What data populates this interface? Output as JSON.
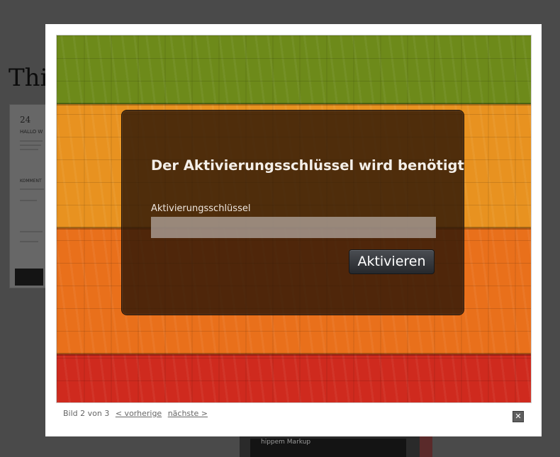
{
  "background_page": {
    "title": "Thi",
    "post_date": "24",
    "post_heading": "HALLO W",
    "comments_label": "KOMMENT",
    "footer_snippet": "hippem Markup"
  },
  "lightbox": {
    "panel": {
      "title": "Der Aktivierungsschlüssel wird benötigt",
      "field_label": "Aktivierungsschlüssel",
      "field_value": "",
      "field_placeholder": "",
      "button_label": "Aktivieren"
    },
    "caption": {
      "counter": "Bild 2 von 3",
      "prev_label": "< vorherige",
      "next_label": "nächste >"
    },
    "close_icon": "close-icon",
    "colors": {
      "green": "#6d8a1a",
      "orange": "#e89220",
      "deep_orange": "#e9701b",
      "red": "#cf2a1e"
    }
  }
}
